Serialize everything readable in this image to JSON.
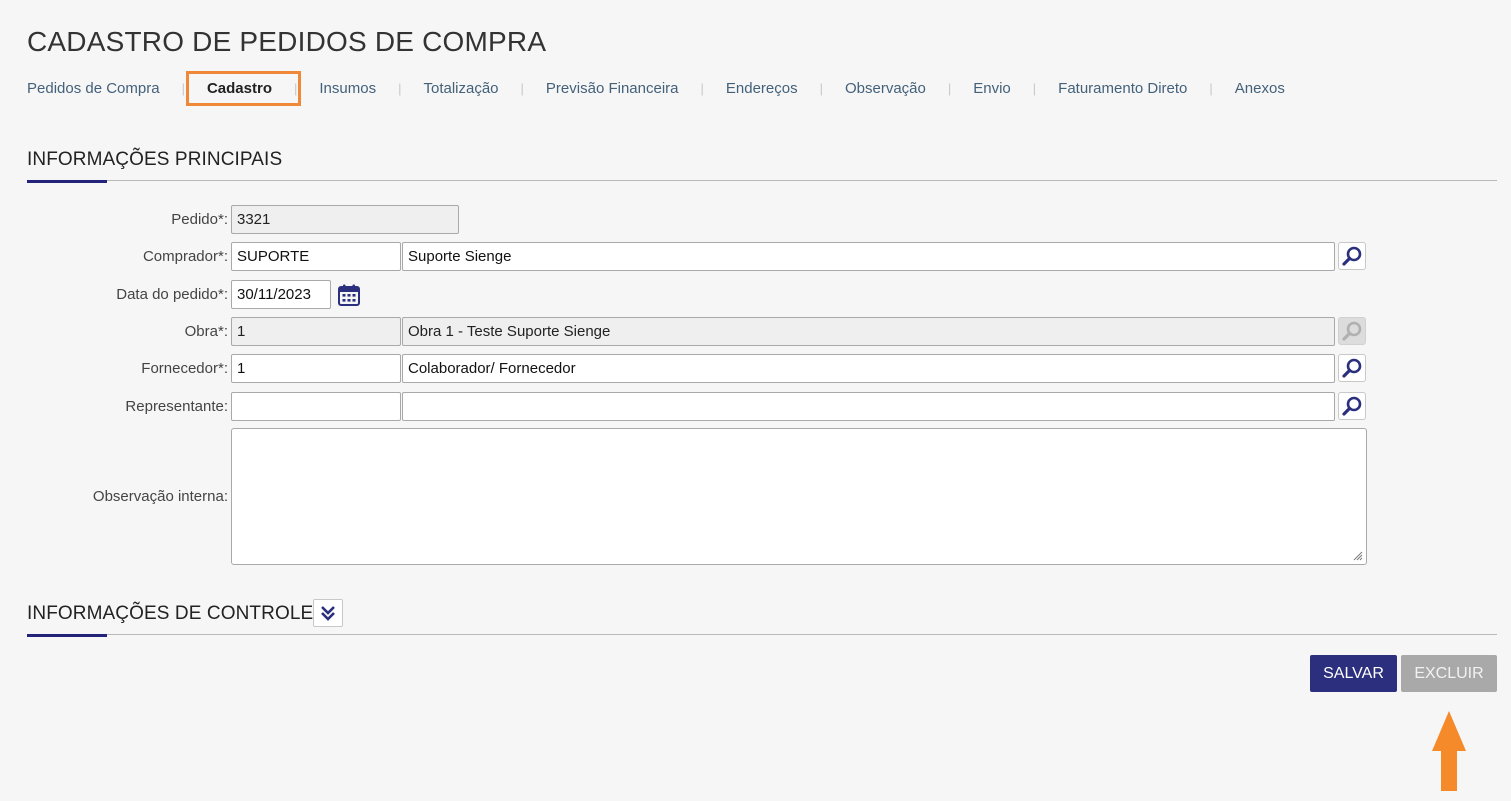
{
  "page_title": "CADASTRO DE PEDIDOS DE COMPRA",
  "tabs": [
    {
      "label": "Pedidos de Compra",
      "active": false
    },
    {
      "label": "Cadastro",
      "active": true
    },
    {
      "label": "Insumos",
      "active": false
    },
    {
      "label": "Totalização",
      "active": false
    },
    {
      "label": "Previsão Financeira",
      "active": false
    },
    {
      "label": "Endereços",
      "active": false
    },
    {
      "label": "Observação",
      "active": false
    },
    {
      "label": "Envio",
      "active": false
    },
    {
      "label": "Faturamento Direto",
      "active": false
    },
    {
      "label": "Anexos",
      "active": false
    }
  ],
  "tab_separator": "|",
  "section_main": {
    "title": "INFORMAÇÕES PRINCIPAIS"
  },
  "form": {
    "pedido": {
      "label": "Pedido*:",
      "value": "3321"
    },
    "comprador": {
      "label": "Comprador*:",
      "code": "SUPORTE",
      "name": "Suporte Sienge"
    },
    "data_pedido": {
      "label": "Data do pedido*:",
      "value": "30/11/2023"
    },
    "obra": {
      "label": "Obra*:",
      "code": "1",
      "name": "Obra 1 - Teste Suporte Sienge"
    },
    "fornecedor": {
      "label": "Fornecedor*:",
      "code": "1",
      "name": "Colaborador/ Fornecedor"
    },
    "representante": {
      "label": "Representante:",
      "code": "",
      "name": ""
    },
    "observacao_interna": {
      "label": "Observação interna:",
      "value": ""
    }
  },
  "section_control": {
    "title": "INFORMAÇÕES DE CONTROLE"
  },
  "buttons": {
    "save": "SALVAR",
    "delete": "EXCLUIR"
  },
  "colors": {
    "primary": "#2b2f7e",
    "highlight": "#f0883a",
    "link": "#44617a",
    "disabled": "#a9a9a9"
  },
  "icons": {
    "search": "magnifier-icon",
    "calendar": "calendar-icon",
    "toggle": "double-chevron-down-icon",
    "annotation": "arrow-up-icon"
  }
}
